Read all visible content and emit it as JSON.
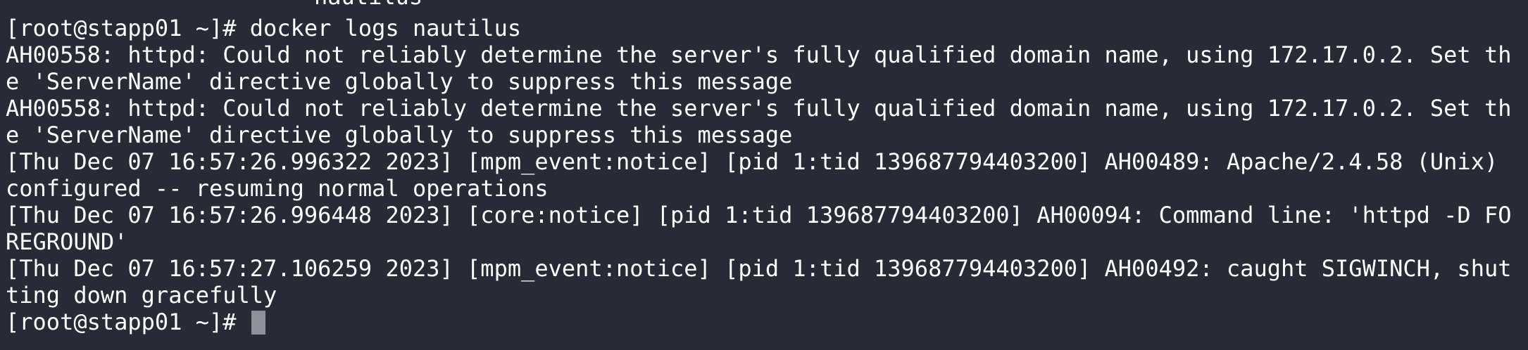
{
  "terminal": {
    "scrollback_fragment": "nautilus",
    "lines": [
      "[root@stapp01 ~]# docker logs nautilus",
      "AH00558: httpd: Could not reliably determine the server's fully qualified domain name, using 172.17.0.2. Set th",
      "e 'ServerName' directive globally to suppress this message",
      "AH00558: httpd: Could not reliably determine the server's fully qualified domain name, using 172.17.0.2. Set th",
      "e 'ServerName' directive globally to suppress this message",
      "[Thu Dec 07 16:57:26.996322 2023] [mpm_event:notice] [pid 1:tid 139687794403200] AH00489: Apache/2.4.58 (Unix)",
      "configured -- resuming normal operations",
      "[Thu Dec 07 16:57:26.996448 2023] [core:notice] [pid 1:tid 139687794403200] AH00094: Command line: 'httpd -D FO",
      "REGROUND'",
      "[Thu Dec 07 16:57:27.106259 2023] [mpm_event:notice] [pid 1:tid 139687794403200] AH00492: caught SIGWINCH, shut",
      "ting down gracefully"
    ],
    "prompt": "[root@stapp01 ~]# ",
    "colors": {
      "background": "#282a36",
      "foreground": "#ffffff",
      "cursor": "#8e9099"
    }
  }
}
